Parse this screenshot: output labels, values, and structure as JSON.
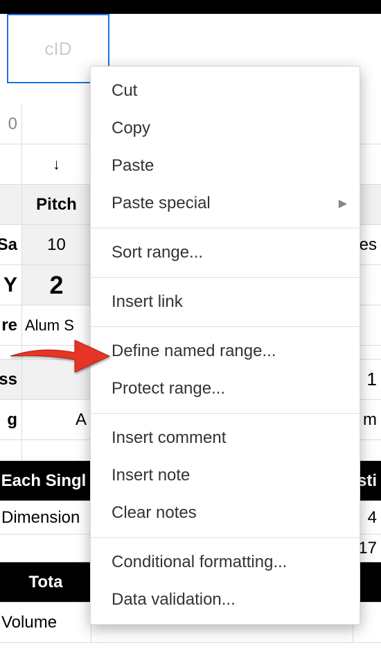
{
  "topbar_text": "",
  "selected_cell_label": "cID",
  "rows": {
    "r0_a": "0",
    "r1_arrow": "↓",
    "r2_a": "",
    "r2_b": "Pitch",
    "r3_a": "Sa",
    "r3_b": "10",
    "r3_d": "es",
    "r4_a": "Y",
    "r4_b": "2",
    "r5_a": "re",
    "r5_b": "Alum S",
    "r6_a": "ss",
    "r6_d": "1",
    "r7_a": "g",
    "r7_b": "A",
    "r7_d": "m",
    "r8_label": "Each Singl",
    "r8_d": "sti",
    "r9_a": "Dimension",
    "r9_d1": "4",
    "r9_d2": "17",
    "r10_label": "Tota",
    "r11_a": "Volume"
  },
  "menu": {
    "cut": "Cut",
    "copy": "Copy",
    "paste": "Paste",
    "paste_special": "Paste special",
    "sort_range": "Sort range...",
    "insert_link": "Insert link",
    "define_named_range": "Define named range...",
    "protect_range": "Protect range...",
    "insert_comment": "Insert comment",
    "insert_note": "Insert note",
    "clear_notes": "Clear notes",
    "conditional_formatting": "Conditional formatting...",
    "data_validation": "Data validation..."
  }
}
